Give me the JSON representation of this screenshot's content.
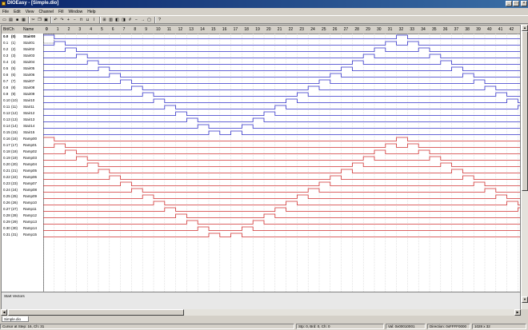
{
  "window": {
    "title": "DIOEasy - [Simple.dio]"
  },
  "menu": [
    "File",
    "Edit",
    "View",
    "Channel",
    "Fill",
    "Window",
    "Help"
  ],
  "toolbar": {
    "icons": [
      "new-icon",
      "open-icon",
      "save-icon",
      "print-icon",
      "cut-icon",
      "copy-icon",
      "paste-icon",
      "undo-icon",
      "redo-icon",
      "zoom-in-icon",
      "zoom-out-icon",
      "fill-high-icon",
      "fill-low-icon",
      "fill-toggle-icon",
      "fill-clock-icon",
      "pattern-icon",
      "insert-icon",
      "delete-icon",
      "grid-icon",
      "calc-icon",
      "help-icon"
    ]
  },
  "grid_header": {
    "bit_col": "Bit/Ch",
    "name_col": "Name",
    "steps": [
      "0",
      "1",
      "2",
      "3",
      "4",
      "5",
      "6",
      "7",
      "8",
      "9",
      "10",
      "11",
      "12",
      "13",
      "14",
      "15",
      "16",
      "17",
      "18",
      "19",
      "20",
      "21",
      "22",
      "23",
      "24",
      "25",
      "26",
      "27",
      "28",
      "29",
      "30",
      "31",
      "32",
      "33",
      "34",
      "35",
      "36",
      "37",
      "38",
      "39",
      "40",
      "41",
      "42"
    ]
  },
  "channels": [
    {
      "bit": "0.0",
      "ch": "(0)",
      "name": "Stair00"
    },
    {
      "bit": "0.1",
      "ch": "(1)",
      "name": "Stair01"
    },
    {
      "bit": "0.2",
      "ch": "(2)",
      "name": "Stair02"
    },
    {
      "bit": "0.3",
      "ch": "(3)",
      "name": "Stair03"
    },
    {
      "bit": "0.4",
      "ch": "(4)",
      "name": "Stair04"
    },
    {
      "bit": "0.5",
      "ch": "(5)",
      "name": "Stair05"
    },
    {
      "bit": "0.6",
      "ch": "(6)",
      "name": "Stair06"
    },
    {
      "bit": "0.7",
      "ch": "(7)",
      "name": "Stair07"
    },
    {
      "bit": "0.8",
      "ch": "(8)",
      "name": "Stair08"
    },
    {
      "bit": "0.9",
      "ch": "(9)",
      "name": "Stair09"
    },
    {
      "bit": "0.10",
      "ch": "(10)",
      "name": "Stair10"
    },
    {
      "bit": "0.11",
      "ch": "(11)",
      "name": "Stair11"
    },
    {
      "bit": "0.12",
      "ch": "(12)",
      "name": "Stair12"
    },
    {
      "bit": "0.13",
      "ch": "(13)",
      "name": "Stair13"
    },
    {
      "bit": "0.14",
      "ch": "(14)",
      "name": "Stair14"
    },
    {
      "bit": "0.15",
      "ch": "(15)",
      "name": "Stair15"
    },
    {
      "bit": "0.16",
      "ch": "(16)",
      "name": "Ramp00"
    },
    {
      "bit": "0.17",
      "ch": "(17)",
      "name": "Ramp01"
    },
    {
      "bit": "0.18",
      "ch": "(18)",
      "name": "Ramp02"
    },
    {
      "bit": "0.19",
      "ch": "(19)",
      "name": "Ramp03"
    },
    {
      "bit": "0.20",
      "ch": "(20)",
      "name": "Ramp04"
    },
    {
      "bit": "0.21",
      "ch": "(21)",
      "name": "Ramp05"
    },
    {
      "bit": "0.22",
      "ch": "(22)",
      "name": "Ramp06"
    },
    {
      "bit": "0.23",
      "ch": "(23)",
      "name": "Ramp07"
    },
    {
      "bit": "0.24",
      "ch": "(24)",
      "name": "Ramp08"
    },
    {
      "bit": "0.25",
      "ch": "(25)",
      "name": "Ramp09"
    },
    {
      "bit": "0.26",
      "ch": "(26)",
      "name": "Ramp10"
    },
    {
      "bit": "0.27",
      "ch": "(27)",
      "name": "Ramp11"
    },
    {
      "bit": "0.28",
      "ch": "(28)",
      "name": "Ramp12"
    },
    {
      "bit": "0.29",
      "ch": "(29)",
      "name": "Ramp13"
    },
    {
      "bit": "0.30",
      "ch": "(30)",
      "name": "Ramp14"
    },
    {
      "bit": "0.31",
      "ch": "(31)",
      "name": "Ramp15"
    }
  ],
  "lower_pane": {
    "label": "Start Vectors"
  },
  "tab": {
    "label": "Simple.dio"
  },
  "status": {
    "cursor": "Cursor at Step: 16, Ch: 31",
    "step": "Stp: 0, Brd: 0, Ch: 0",
    "val": "Val: 0x00010001",
    "direction": "Direction: 0xFFFF0000",
    "size": "1028 x 32"
  },
  "colors": {
    "stair": "#3030c8",
    "ramp": "#d03030",
    "grid": "#c8c8c8",
    "title_bar": "#0a246a"
  }
}
